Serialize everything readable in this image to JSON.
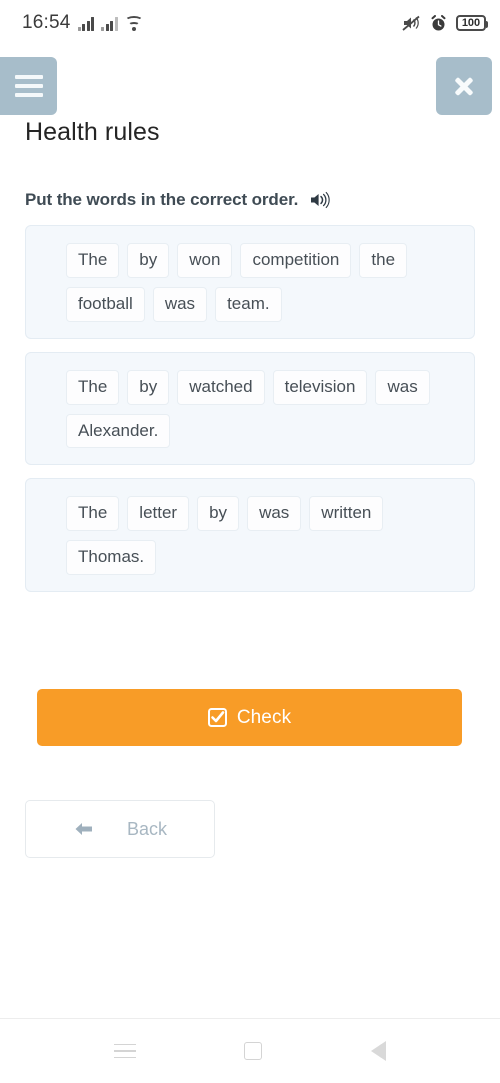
{
  "status_bar": {
    "clock": "16:54",
    "icons": [
      "signal-bars-sim1",
      "signal-bars-sim2",
      "wifi-icon",
      "mute-icon",
      "alarm-icon"
    ],
    "battery_level": "100"
  },
  "header": {
    "menu_label": "menu",
    "close_label": "close",
    "title": "Health rules",
    "button_color": "#a7bdca"
  },
  "instruction": {
    "text": "Put the words in the correct order.",
    "audio_icon": "speaker-icon"
  },
  "exercises": [
    {
      "id": "sentence-1",
      "words": [
        "The",
        "by",
        "won",
        "competition",
        "the",
        "football",
        "was",
        "team."
      ]
    },
    {
      "id": "sentence-2",
      "words": [
        "The",
        "by",
        "watched",
        "television",
        "was",
        "Alexander."
      ]
    },
    {
      "id": "sentence-3",
      "words": [
        "The",
        "letter",
        "by",
        "was",
        "written",
        "Thomas."
      ]
    }
  ],
  "actions": {
    "check_label": "Check",
    "check_icon": "check-square-icon",
    "check_color": "#f89c27",
    "back_label": "Back",
    "back_icon": "arrow-left-icon",
    "back_text_color": "#a8b7c2"
  },
  "nav_bar": {
    "recents_label": "recents",
    "home_label": "home",
    "back_label": "back"
  }
}
